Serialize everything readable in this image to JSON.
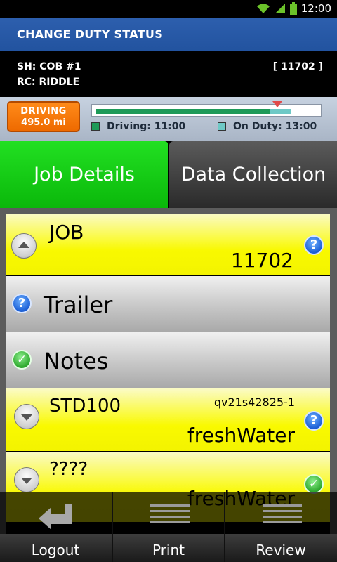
{
  "status": {
    "time": "12:00"
  },
  "header": {
    "title": "CHANGE DUTY STATUS"
  },
  "info": {
    "sh": "SH: COB #1",
    "rc": "RC: RIDDLE",
    "job_number": "[ 11702 ]"
  },
  "driving_button": {
    "line1": "DRIVING",
    "line2": "495.0 mi"
  },
  "hours": {
    "driving_label": "Driving: 11:00",
    "on_duty_label": "On Duty: 13:00",
    "driving_fraction": 0.787,
    "on_duty_fraction": 0.095,
    "driving_color": "#1e9a58",
    "on_duty_color": "#6ec9c6",
    "marker_color": "#e04a4a"
  },
  "tabs": [
    {
      "label": "Job Details",
      "active": true
    },
    {
      "label": "Data Collection",
      "active": false
    }
  ],
  "rows": [
    {
      "title": "JOB",
      "value": "11702",
      "icon": "help-icon"
    },
    {
      "title": "Trailer",
      "icon": "help-icon"
    },
    {
      "title": "Notes",
      "icon": "check-icon"
    },
    {
      "title": "STD100",
      "code": "qv21s42825-1",
      "value": "freshWater",
      "icon": "help-icon"
    },
    {
      "title": "????",
      "value": "freshWater",
      "icon": "check-icon"
    }
  ],
  "bottom": {
    "logout": "Logout",
    "print": "Print",
    "review": "Review"
  },
  "colors": {
    "title_bar": "#2d5fae",
    "active_tab": "#0ab80a",
    "row_yellow": "#f9f900",
    "driving_orange": "#ee6a00"
  }
}
